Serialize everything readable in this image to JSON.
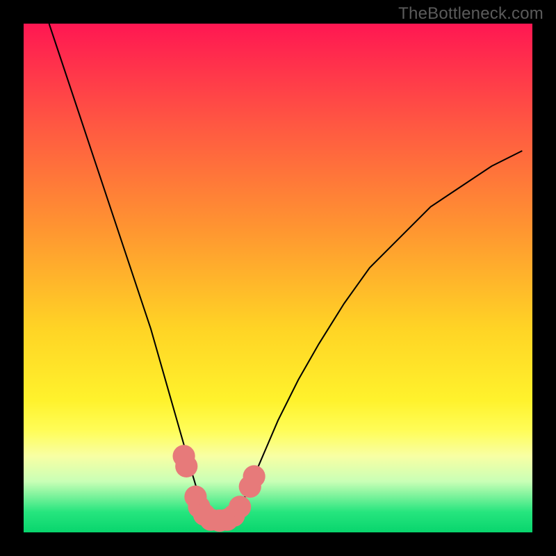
{
  "watermark": "TheBottleneck.com",
  "chart_data": {
    "type": "line",
    "title": "",
    "xlabel": "",
    "ylabel": "",
    "xlim": [
      0,
      100
    ],
    "ylim": [
      0,
      100
    ],
    "grid": false,
    "background_gradient": {
      "stops": [
        {
          "offset": 0,
          "color": "#ff1752"
        },
        {
          "offset": 20,
          "color": "#ff5842"
        },
        {
          "offset": 40,
          "color": "#ff9431"
        },
        {
          "offset": 60,
          "color": "#ffd425"
        },
        {
          "offset": 74,
          "color": "#fff22c"
        },
        {
          "offset": 80,
          "color": "#fffd58"
        },
        {
          "offset": 85,
          "color": "#f8ffa4"
        },
        {
          "offset": 90,
          "color": "#c9ffb6"
        },
        {
          "offset": 96,
          "color": "#26e57e"
        },
        {
          "offset": 100,
          "color": "#08d56d"
        }
      ]
    },
    "series": [
      {
        "name": "bottleneck-curve",
        "color": "#000000",
        "x": [
          5,
          8,
          11,
          14,
          17,
          20,
          23,
          25,
          27,
          29,
          31,
          33,
          34.5,
          36,
          38,
          40,
          42,
          44,
          47,
          50,
          54,
          58,
          63,
          68,
          74,
          80,
          86,
          92,
          98
        ],
        "y": [
          100,
          91,
          82,
          73,
          64,
          55,
          46,
          40,
          33,
          26,
          19,
          12,
          7,
          4,
          2,
          2,
          4,
          8,
          15,
          22,
          30,
          37,
          45,
          52,
          58,
          64,
          68,
          72,
          75
        ]
      }
    ],
    "markers": {
      "name": "highlight-cluster",
      "color": "#e77a7a",
      "radius": 2.2,
      "points": [
        {
          "x": 31.5,
          "y": 15
        },
        {
          "x": 32.0,
          "y": 13
        },
        {
          "x": 33.8,
          "y": 7
        },
        {
          "x": 34.5,
          "y": 5
        },
        {
          "x": 35.5,
          "y": 3.5
        },
        {
          "x": 36.8,
          "y": 2.5
        },
        {
          "x": 38.5,
          "y": 2.3
        },
        {
          "x": 40.0,
          "y": 2.5
        },
        {
          "x": 41.3,
          "y": 3.3
        },
        {
          "x": 42.5,
          "y": 5.0
        },
        {
          "x": 44.5,
          "y": 9.0
        },
        {
          "x": 45.3,
          "y": 11.0
        }
      ]
    }
  }
}
